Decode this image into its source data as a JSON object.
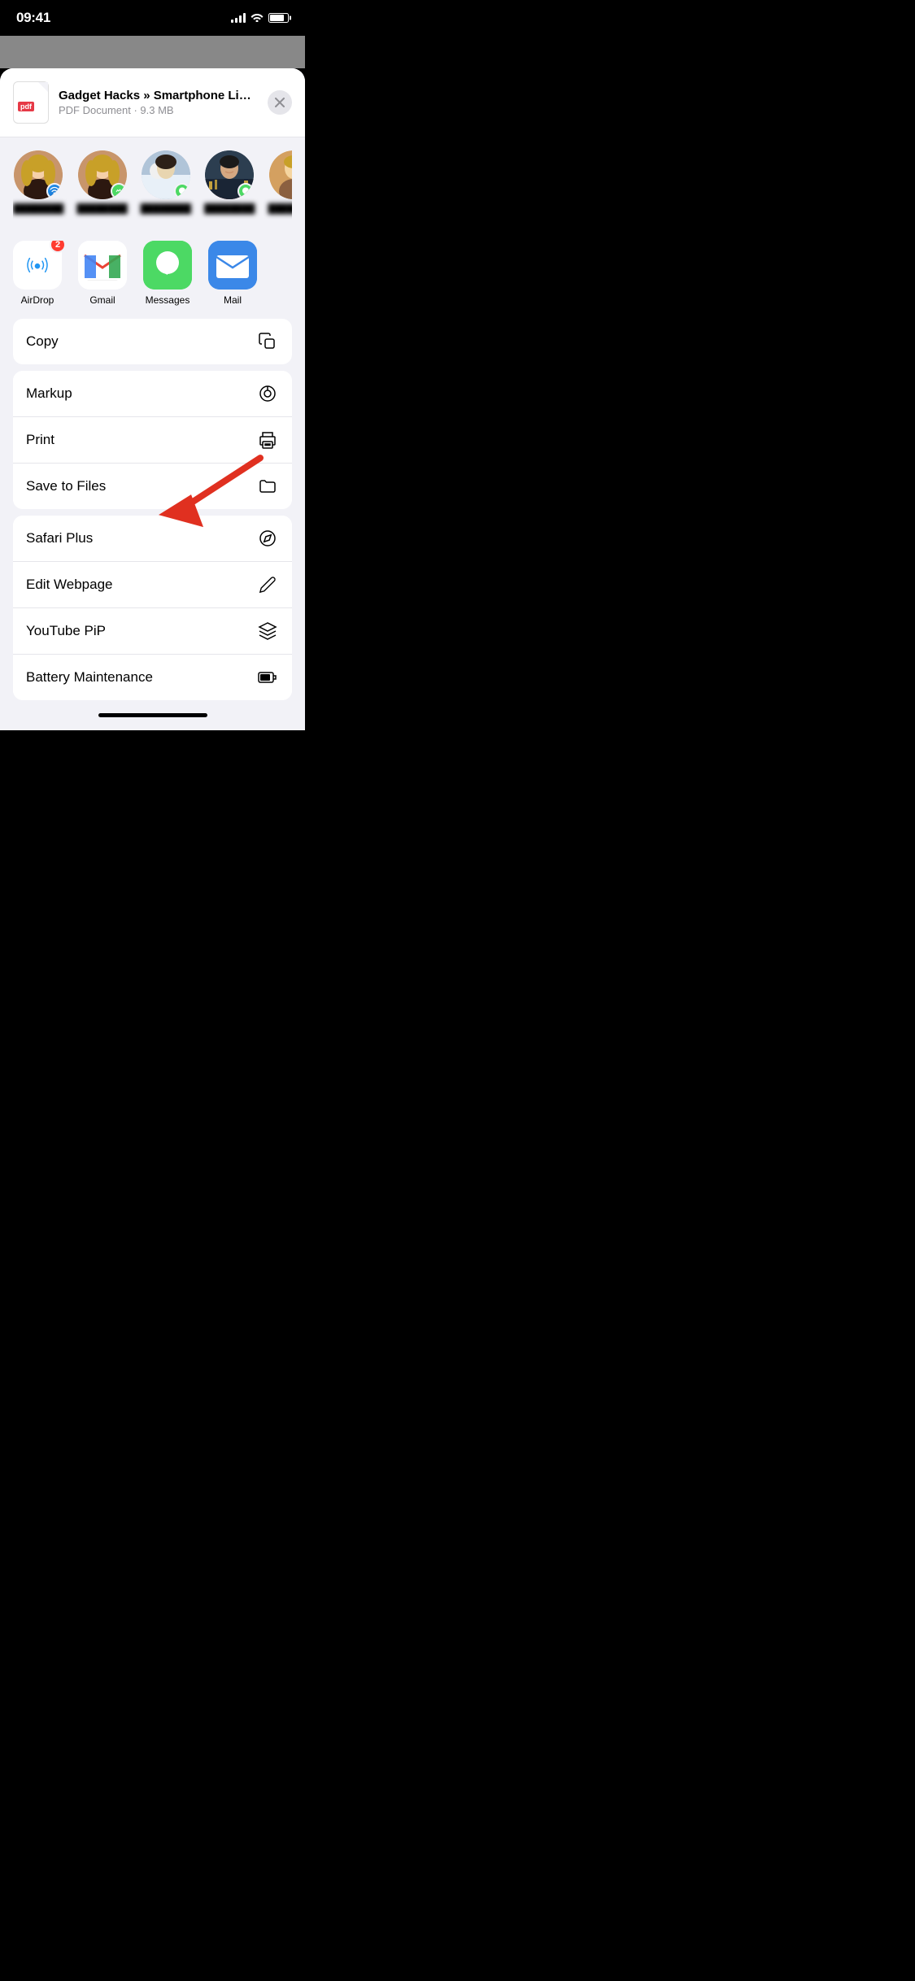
{
  "statusBar": {
    "time": "09:41",
    "signalBars": 4,
    "batteryPercent": 80
  },
  "filePreview": {
    "type": "PDF",
    "title": "Gadget Hacks » Smartphone Lifehacks, G...",
    "meta": "PDF Document · 9.3 MB",
    "closeLabel": "×"
  },
  "contacts": [
    {
      "id": 1,
      "name": "Contact 1",
      "avatarClass": "avatar-bg-1",
      "badge": "airdrop"
    },
    {
      "id": 2,
      "name": "Contact 2",
      "avatarClass": "avatar-bg-2",
      "badge": "messages"
    },
    {
      "id": 3,
      "name": "Contact 3",
      "avatarClass": "avatar-bg-3",
      "badge": "messages"
    },
    {
      "id": 4,
      "name": "Contact 4",
      "avatarClass": "avatar-bg-4",
      "badge": "messages"
    },
    {
      "id": 5,
      "name": "Contact 5",
      "avatarClass": "avatar-bg-5",
      "badge": "messages"
    }
  ],
  "apps": [
    {
      "id": "airdrop",
      "label": "AirDrop",
      "badge": "2"
    },
    {
      "id": "gmail",
      "label": "Gmail",
      "badge": null
    },
    {
      "id": "messages",
      "label": "Messages",
      "badge": null
    },
    {
      "id": "mail",
      "label": "Mail",
      "badge": null
    }
  ],
  "actions": [
    {
      "id": "copy",
      "label": "Copy",
      "icon": "copy"
    },
    {
      "id": "markup",
      "label": "Markup",
      "icon": "markup"
    },
    {
      "id": "print",
      "label": "Print",
      "icon": "print"
    },
    {
      "id": "save-to-files",
      "label": "Save to Files",
      "icon": "folder"
    },
    {
      "id": "safari-plus",
      "label": "Safari Plus",
      "icon": "compass"
    },
    {
      "id": "edit-webpage",
      "label": "Edit Webpage",
      "icon": "pencil"
    },
    {
      "id": "youtube-pip",
      "label": "YouTube PiP",
      "icon": "layers"
    },
    {
      "id": "battery-maintenance",
      "label": "Battery Maintenance",
      "icon": "battery"
    }
  ],
  "colors": {
    "background": "#000000",
    "sheetBackground": "#f2f2f7",
    "actionBackground": "#ffffff",
    "accent": "#007aff",
    "destructive": "#ff3b30",
    "redArrow": "#e03020"
  }
}
